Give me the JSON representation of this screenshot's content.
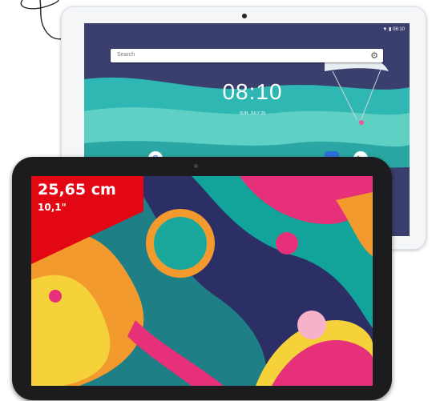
{
  "back_tablet": {
    "search_placeholder": "Search",
    "clock": "08:10",
    "date": "SUN, JULY 25"
  },
  "front_tablet": {
    "size_cm": "25,65 cm",
    "size_inch": "10,1\""
  },
  "colors": {
    "badge_red": "#e30613",
    "tablet_black": "#1c1c1e",
    "tablet_white": "#f5f6f8"
  },
  "icons": [
    "gear-icon",
    "google-icon",
    "play-store-icon",
    "camera-icon"
  ]
}
